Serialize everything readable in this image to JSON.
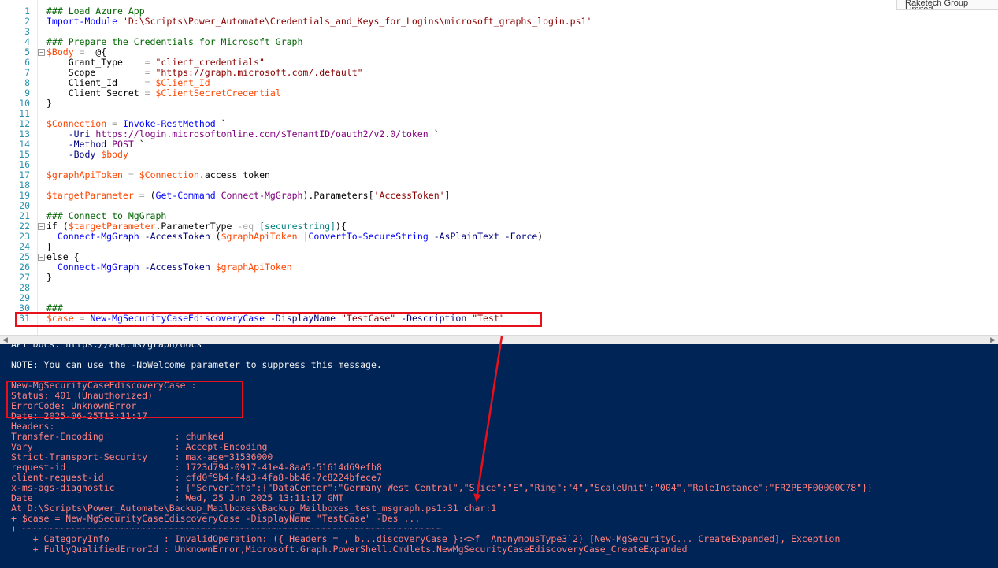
{
  "topright_tab": "Raketech Group Limited",
  "colors": {
    "console_bg": "#012456",
    "annotation_red": "#e8101a",
    "line_number": "#2b91af"
  },
  "editor": {
    "lines": [
      {
        "n": "1",
        "fold": "",
        "tokens": [
          {
            "c": "t-cm",
            "t": "### Load Azure App"
          }
        ]
      },
      {
        "n": "2",
        "fold": "",
        "tokens": [
          {
            "c": "t-cmd",
            "t": "Import-Module"
          },
          {
            "c": "t-pl",
            "t": " "
          },
          {
            "c": "t-str",
            "t": "'D:\\Scripts\\Power_Automate\\Credentials_and_Keys_for_Logins\\microsoft_graphs_login.ps1'"
          }
        ]
      },
      {
        "n": "3",
        "fold": "",
        "tokens": []
      },
      {
        "n": "4",
        "fold": "",
        "tokens": [
          {
            "c": "t-cm",
            "t": "### Prepare the Credentials for Microsoft Graph"
          }
        ]
      },
      {
        "n": "5",
        "fold": "⊟",
        "tokens": [
          {
            "c": "t-var",
            "t": "$Body"
          },
          {
            "c": "t-pl",
            "t": " "
          },
          {
            "c": "t-op",
            "t": "="
          },
          {
            "c": "t-pl",
            "t": "  @{"
          }
        ]
      },
      {
        "n": "6",
        "fold": "",
        "tokens": [
          {
            "c": "t-pl",
            "t": "    Grant_Type    "
          },
          {
            "c": "t-op",
            "t": "="
          },
          {
            "c": "t-pl",
            "t": " "
          },
          {
            "c": "t-str",
            "t": "\"client_credentials\""
          }
        ]
      },
      {
        "n": "7",
        "fold": "",
        "tokens": [
          {
            "c": "t-pl",
            "t": "    Scope         "
          },
          {
            "c": "t-op",
            "t": "="
          },
          {
            "c": "t-pl",
            "t": " "
          },
          {
            "c": "t-str",
            "t": "\"https://graph.microsoft.com/.default\""
          }
        ]
      },
      {
        "n": "8",
        "fold": "",
        "tokens": [
          {
            "c": "t-pl",
            "t": "    Client_Id     "
          },
          {
            "c": "t-op",
            "t": "="
          },
          {
            "c": "t-pl",
            "t": " "
          },
          {
            "c": "t-var",
            "t": "$Client_Id"
          }
        ]
      },
      {
        "n": "9",
        "fold": "",
        "tokens": [
          {
            "c": "t-pl",
            "t": "    Client_Secret "
          },
          {
            "c": "t-op",
            "t": "="
          },
          {
            "c": "t-pl",
            "t": " "
          },
          {
            "c": "t-var",
            "t": "$ClientSecretCredential"
          }
        ]
      },
      {
        "n": "10",
        "fold": "",
        "tokens": [
          {
            "c": "t-pl",
            "t": "}"
          }
        ]
      },
      {
        "n": "11",
        "fold": "",
        "tokens": []
      },
      {
        "n": "12",
        "fold": "",
        "tokens": [
          {
            "c": "t-var",
            "t": "$Connection"
          },
          {
            "c": "t-pl",
            "t": " "
          },
          {
            "c": "t-op",
            "t": "="
          },
          {
            "c": "t-pl",
            "t": " "
          },
          {
            "c": "t-cmd",
            "t": "Invoke-RestMethod"
          },
          {
            "c": "t-pl",
            "t": " `"
          }
        ]
      },
      {
        "n": "13",
        "fold": "",
        "tokens": [
          {
            "c": "t-pl",
            "t": "    "
          },
          {
            "c": "t-prm",
            "t": "-Uri"
          },
          {
            "c": "t-pl",
            "t": " "
          },
          {
            "c": "t-num",
            "t": "https://login.microsoftonline.com/$TenantID/oauth2/v2.0/token"
          },
          {
            "c": "t-pl",
            "t": " `"
          }
        ]
      },
      {
        "n": "14",
        "fold": "",
        "tokens": [
          {
            "c": "t-pl",
            "t": "    "
          },
          {
            "c": "t-prm",
            "t": "-Method"
          },
          {
            "c": "t-pl",
            "t": " "
          },
          {
            "c": "t-num",
            "t": "POST"
          },
          {
            "c": "t-pl",
            "t": " `"
          }
        ]
      },
      {
        "n": "15",
        "fold": "",
        "tokens": [
          {
            "c": "t-pl",
            "t": "    "
          },
          {
            "c": "t-prm",
            "t": "-Body"
          },
          {
            "c": "t-pl",
            "t": " "
          },
          {
            "c": "t-var",
            "t": "$body"
          }
        ]
      },
      {
        "n": "16",
        "fold": "",
        "tokens": []
      },
      {
        "n": "17",
        "fold": "",
        "tokens": [
          {
            "c": "t-var",
            "t": "$graphApiToken"
          },
          {
            "c": "t-pl",
            "t": " "
          },
          {
            "c": "t-op",
            "t": "="
          },
          {
            "c": "t-pl",
            "t": " "
          },
          {
            "c": "t-var",
            "t": "$Connection"
          },
          {
            "c": "t-pl",
            "t": "."
          },
          {
            "c": "t-prop",
            "t": "access_token"
          }
        ]
      },
      {
        "n": "18",
        "fold": "",
        "tokens": []
      },
      {
        "n": "19",
        "fold": "",
        "tokens": [
          {
            "c": "t-var",
            "t": "$targetParameter"
          },
          {
            "c": "t-pl",
            "t": " "
          },
          {
            "c": "t-op",
            "t": "="
          },
          {
            "c": "t-pl",
            "t": " ("
          },
          {
            "c": "t-cmd",
            "t": "Get-Command"
          },
          {
            "c": "t-pl",
            "t": " "
          },
          {
            "c": "t-num",
            "t": "Connect-MgGraph"
          },
          {
            "c": "t-pl",
            "t": ")."
          },
          {
            "c": "t-prop",
            "t": "Parameters"
          },
          {
            "c": "t-pl",
            "t": "["
          },
          {
            "c": "t-str",
            "t": "'AccessToken'"
          },
          {
            "c": "t-pl",
            "t": "]"
          }
        ]
      },
      {
        "n": "20",
        "fold": "",
        "tokens": []
      },
      {
        "n": "21",
        "fold": "",
        "tokens": [
          {
            "c": "t-cm",
            "t": "### Connect to MgGraph"
          }
        ]
      },
      {
        "n": "22",
        "fold": "⊟",
        "tokens": [
          {
            "c": "t-pl",
            "t": "if ("
          },
          {
            "c": "t-var",
            "t": "$targetParameter"
          },
          {
            "c": "t-pl",
            "t": "."
          },
          {
            "c": "t-prop",
            "t": "ParameterType"
          },
          {
            "c": "t-pl",
            "t": " "
          },
          {
            "c": "t-op",
            "t": "-eq"
          },
          {
            "c": "t-pl",
            "t": " "
          },
          {
            "c": "t-type",
            "t": "[securestring]"
          },
          {
            "c": "t-pl",
            "t": "){"
          }
        ]
      },
      {
        "n": "23",
        "fold": "",
        "tokens": [
          {
            "c": "t-pl",
            "t": "  "
          },
          {
            "c": "t-cmd",
            "t": "Connect-MgGraph"
          },
          {
            "c": "t-pl",
            "t": " "
          },
          {
            "c": "t-prm",
            "t": "-AccessToken"
          },
          {
            "c": "t-pl",
            "t": " ("
          },
          {
            "c": "t-var",
            "t": "$graphApiToken"
          },
          {
            "c": "t-pl",
            "t": " "
          },
          {
            "c": "t-op",
            "t": "|"
          },
          {
            "c": "t-cmd",
            "t": "ConvertTo-SecureString"
          },
          {
            "c": "t-pl",
            "t": " "
          },
          {
            "c": "t-prm",
            "t": "-AsPlainText"
          },
          {
            "c": "t-pl",
            "t": " "
          },
          {
            "c": "t-prm",
            "t": "-Force"
          },
          {
            "c": "t-pl",
            "t": ")"
          }
        ]
      },
      {
        "n": "24",
        "fold": "",
        "tokens": [
          {
            "c": "t-pl",
            "t": "}"
          }
        ]
      },
      {
        "n": "25",
        "fold": "⊟",
        "tokens": [
          {
            "c": "t-pl",
            "t": "else {"
          }
        ]
      },
      {
        "n": "26",
        "fold": "",
        "tokens": [
          {
            "c": "t-pl",
            "t": "  "
          },
          {
            "c": "t-cmd",
            "t": "Connect-MgGraph"
          },
          {
            "c": "t-pl",
            "t": " "
          },
          {
            "c": "t-prm",
            "t": "-AccessToken"
          },
          {
            "c": "t-pl",
            "t": " "
          },
          {
            "c": "t-var",
            "t": "$graphApiToken"
          }
        ]
      },
      {
        "n": "27",
        "fold": "",
        "tokens": [
          {
            "c": "t-pl",
            "t": "}"
          }
        ]
      },
      {
        "n": "28",
        "fold": "",
        "tokens": []
      },
      {
        "n": "29",
        "fold": "",
        "tokens": []
      },
      {
        "n": "30",
        "fold": "",
        "tokens": [
          {
            "c": "t-cm",
            "t": "###"
          }
        ]
      },
      {
        "n": "31",
        "fold": "",
        "tokens": [
          {
            "c": "t-var",
            "t": "$case"
          },
          {
            "c": "t-pl",
            "t": " "
          },
          {
            "c": "t-op",
            "t": "="
          },
          {
            "c": "t-pl",
            "t": " "
          },
          {
            "c": "t-cmd",
            "t": "New-MgSecurityCaseEdiscoveryCase"
          },
          {
            "c": "t-pl",
            "t": " "
          },
          {
            "c": "t-prm",
            "t": "-DisplayName"
          },
          {
            "c": "t-pl",
            "t": " "
          },
          {
            "c": "t-str",
            "t": "\"TestCase\""
          },
          {
            "c": "t-pl",
            "t": " "
          },
          {
            "c": "t-prm",
            "t": "-Description"
          },
          {
            "c": "t-pl",
            "t": " "
          },
          {
            "c": "t-str",
            "t": "\"Test\""
          }
        ]
      }
    ]
  },
  "console": {
    "lines": [
      {
        "cls": "c-white",
        "text": "API Docs: https://aka.ms/graph/docs"
      },
      {
        "cls": "c-white",
        "text": ""
      },
      {
        "cls": "c-white",
        "text": "NOTE: You can use the -NoWelcome parameter to suppress this message."
      },
      {
        "cls": "c-white",
        "text": ""
      },
      {
        "cls": "c-red",
        "text": "New-MgSecurityCaseEdiscoveryCase :"
      },
      {
        "cls": "c-red",
        "text": "Status: 401 (Unauthorized)"
      },
      {
        "cls": "c-red",
        "text": "ErrorCode: UnknownError"
      },
      {
        "cls": "c-red",
        "text": "Date: 2025-06-25T13:11:17"
      },
      {
        "cls": "c-red",
        "text": "Headers:"
      },
      {
        "cls": "c-red",
        "text": "Transfer-Encoding             : chunked"
      },
      {
        "cls": "c-red",
        "text": "Vary                          : Accept-Encoding"
      },
      {
        "cls": "c-red",
        "text": "Strict-Transport-Security     : max-age=31536000"
      },
      {
        "cls": "c-red",
        "text": "request-id                    : 1723d794-0917-41e4-8aa5-51614d69efb8"
      },
      {
        "cls": "c-red",
        "text": "client-request-id             : cfd0f9b4-f4a3-4fa8-bb46-7c8224bfece7"
      },
      {
        "cls": "c-red",
        "text": "x-ms-ags-diagnostic           : {\"ServerInfo\":{\"DataCenter\":\"Germany West Central\",\"Slice\":\"E\",\"Ring\":\"4\",\"ScaleUnit\":\"004\",\"RoleInstance\":\"FR2PEPF00000C78\"}}"
      },
      {
        "cls": "c-red",
        "text": "Date                          : Wed, 25 Jun 2025 13:11:17 GMT"
      },
      {
        "cls": "c-red",
        "text": "At D:\\Scripts\\Power_Automate\\Backup_Mailboxes\\Backup_Mailboxes_test_msgraph.ps1:31 char:1"
      },
      {
        "cls": "c-red",
        "text": "+ $case = New-MgSecurityCaseEdiscoveryCase -DisplayName \"TestCase\" -Des ..."
      },
      {
        "cls": "c-red",
        "text": "+ ~~~~~~~~~~~~~~~~~~~~~~~~~~~~~~~~~~~~~~~~~~~~~~~~~~~~~~~~~~~~~~~~~~~~~~~~~~~~~"
      },
      {
        "cls": "c-red",
        "text": "    + CategoryInfo          : InvalidOperation: ({ Headers = , b...discoveryCase }:<>f__AnonymousType3`2) [New-MgSecurityC..._CreateExpanded], Exception"
      },
      {
        "cls": "c-red",
        "text": "    + FullyQualifiedErrorId : UnknownError,Microsoft.Graph.PowerShell.Cmdlets.NewMgSecurityCaseEdiscoveryCase_CreateExpanded"
      }
    ]
  }
}
